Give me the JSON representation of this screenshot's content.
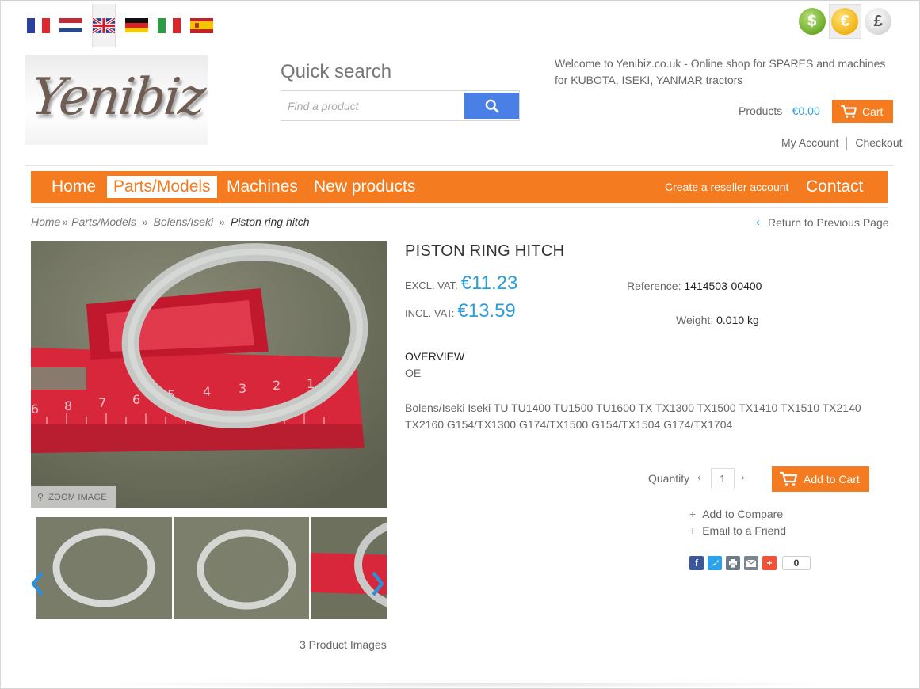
{
  "languages": [
    {
      "name": "french-flag",
      "active": false
    },
    {
      "name": "dutch-flag",
      "active": false
    },
    {
      "name": "uk-flag",
      "active": true
    },
    {
      "name": "german-flag",
      "active": false
    },
    {
      "name": "italian-flag",
      "active": false
    },
    {
      "name": "spanish-flag",
      "active": false
    }
  ],
  "currencies": {
    "dollar": "$",
    "euro": "€",
    "pound": "£",
    "selected": "euro"
  },
  "logo": {
    "text": "Yenibiz"
  },
  "search": {
    "title": "Quick search",
    "placeholder": "Find a product",
    "value": "",
    "button_icon": "search-icon"
  },
  "header": {
    "welcome": "Welcome to Yenibiz.co.uk - Online shop for SPARES and machines for KUBOTA, ISEKI, YANMAR tractors",
    "products_label": "Products - ",
    "products_amount": "€0.00",
    "cart_label": "Cart",
    "my_account": "My Account",
    "checkout": "Checkout"
  },
  "nav": {
    "items": [
      {
        "label": "Home",
        "active": false
      },
      {
        "label": "Parts/Models",
        "active": true
      },
      {
        "label": "Machines",
        "active": false
      },
      {
        "label": "New products",
        "active": false
      }
    ],
    "reseller": "Create a reseller account",
    "contact": "Contact"
  },
  "breadcrumb": {
    "items": [
      "Home",
      "Parts/Models",
      "Bolens/Iseki"
    ],
    "separators": [
      "»",
      "»",
      "»"
    ],
    "current": "Piston ring hitch",
    "return_label": "Return to Previous Page"
  },
  "gallery": {
    "zoom_label": "ZOOM IMAGE",
    "image_count": "3 Product Images",
    "ruler_numbers": [
      "6",
      "8",
      "7",
      "6",
      "5",
      "4",
      "3",
      "2",
      "1"
    ]
  },
  "product": {
    "title": "PISTON RING HITCH",
    "excl_label": "EXCL. VAT:",
    "excl_price": "€11.23",
    "incl_label": "INCL. VAT:",
    "incl_price": "€13.59",
    "reference_label": "Reference:",
    "reference": "1414503-00400",
    "weight_label": "Weight:",
    "weight": "0.010 kg",
    "overview_title": "OVERVIEW",
    "overview_short": "OE",
    "description": "Bolens/Iseki Iseki TU TU1400 TU1500 TU1600 TX TX1300 TX1500 TX1410 TX1510 TX2140 TX2160 G154/TX1300 G174/TX1500 G154/TX1504 G174/TX1704",
    "quantity_label": "Quantity",
    "quantity_value": "1",
    "qty_prev": "‹",
    "qty_next": "›",
    "add_to_cart": "Add to Cart",
    "add_to_compare": "Add to Compare",
    "email_friend": "Email to a Friend",
    "share_count": "0"
  },
  "colors": {
    "accent": "#f47b20",
    "price": "#2c9fd8",
    "search_button": "#4a7fe6"
  }
}
